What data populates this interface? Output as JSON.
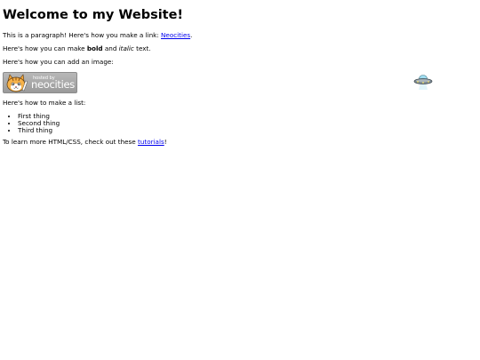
{
  "heading": "Welcome to my Website!",
  "para_link": {
    "before": "This is a paragraph! Here's how you make a link: ",
    "link": "Neocities",
    "after": "."
  },
  "para_format": {
    "before": "Here's how you can make ",
    "bold": "bold",
    "middle": " and ",
    "italic": "italic",
    "after": " text."
  },
  "para_image": "Here's how you can add an image:",
  "badge": {
    "small": "hosted by",
    "big": "neocities"
  },
  "para_list": "Here's how to make a list:",
  "list_items": [
    "First thing",
    "Second thing",
    "Third thing"
  ],
  "para_learn": {
    "before": "To learn more HTML/CSS, check out these ",
    "link": "tutorials",
    "after": "!"
  },
  "colors": {
    "link": "#0000ee",
    "badge_bg": "#a8a8a8"
  },
  "icons": {
    "badge_mascot": "neocities-cat-icon",
    "floating": "ufo-icon"
  }
}
